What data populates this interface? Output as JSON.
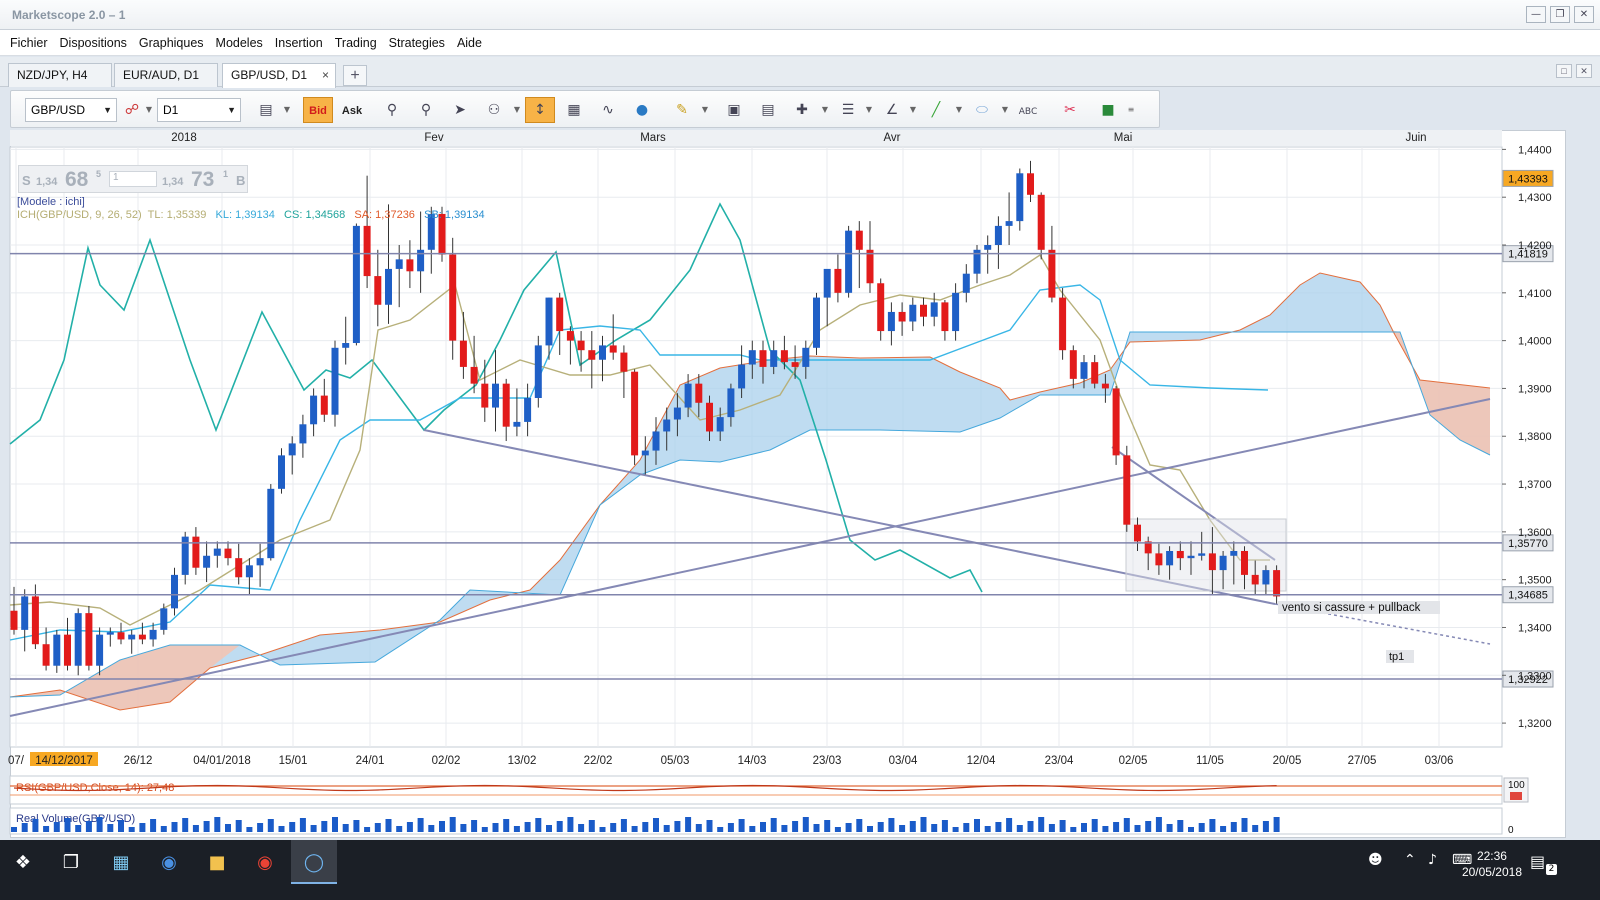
{
  "window": {
    "title": "Marketscope 2.0 – 1",
    "buttons": [
      "minimize",
      "restore",
      "close"
    ]
  },
  "menu": [
    "Fichier",
    "Dispositions",
    "Graphiques",
    "Modeles",
    "Insertion",
    "Trading",
    "Strategies",
    "Aide"
  ],
  "tabs": [
    {
      "label": "NZD/JPY, H4",
      "active": false
    },
    {
      "label": "EUR/AUD, D1",
      "active": false
    },
    {
      "label": "GBP/USD, D1",
      "active": true
    }
  ],
  "toolbar": {
    "instrument": "GBP/USD",
    "timeframe": "D1",
    "bid_label": "Bid",
    "ask_label": "Ask"
  },
  "quote": {
    "sell_prefix": "S",
    "sell_small": "1,34",
    "sell_big": "68",
    "sell_sup": "5",
    "qty": "1",
    "buy_small": "1,34",
    "buy_big": "73",
    "buy_sup": "1",
    "buy_suffix": "B"
  },
  "legend": {
    "model": "[Modele : ichi]",
    "ich_prefix": "ICH(GBP/USD, 9, 26, 52)",
    "tl": "TL: 1,35339",
    "kl": "KL: 1,39134",
    "cs": "CS: 1,34568",
    "sa": "SA: 1,37236",
    "sb": "SB: 1,39134"
  },
  "annotations": {
    "note": "vento si cassure + pullback",
    "tp": "tp1"
  },
  "price_tags": [
    "1,43393",
    "1,41819",
    "1,35770",
    "1,34685",
    "1,32922"
  ],
  "indicators": {
    "rsi": "RSI(GBP/USD,Close, 14): 27,48",
    "rsi_top": "100",
    "volume": "Real Volume(GBP/USD)",
    "vol_zero": "0"
  },
  "taskbar": {
    "time": "22:36",
    "date": "20/05/2018",
    "notifications": "2"
  },
  "chart_data": {
    "type": "candlestick",
    "top_axis_labels": [
      "2018",
      "Fev",
      "Mars",
      "Avr",
      "Mai",
      "Juin"
    ],
    "x_axis_labels": [
      "07/",
      "14/12/2017",
      "26/12",
      "04/01/2018",
      "15/01",
      "24/01",
      "02/02",
      "13/02",
      "22/02",
      "05/03",
      "14/03",
      "23/03",
      "03/04",
      "12/04",
      "23/04",
      "02/05",
      "11/05",
      "20/05",
      "27/05",
      "03/06"
    ],
    "y_ticks": [
      "1,4400",
      "1,4300",
      "1,4200",
      "1,4100",
      "1,4000",
      "1,3900",
      "1,3800",
      "1,3700",
      "1,3600",
      "1,3500",
      "1,3400",
      "1,3300",
      "1,3200"
    ],
    "y_range": [
      1.315,
      1.4405
    ],
    "horizontal_levels": [
      1.41819,
      1.3577,
      1.34685,
      1.32922
    ],
    "current_price": 1.43393,
    "colors": {
      "up": "#1f5fc6",
      "down": "#e21b1b",
      "tenkan": "#b7b07a",
      "kijun": "#39b6e6",
      "chikou": "#22b0a8",
      "span_bull": "#a9d0ec",
      "span_bear": "#f4c3b0",
      "lines": "#8b8fb8"
    },
    "candles": [
      {
        "o": 1.3435,
        "h": 1.3485,
        "l": 1.3385,
        "c": 1.3395
      },
      {
        "o": 1.3395,
        "h": 1.348,
        "l": 1.335,
        "c": 1.3465
      },
      {
        "o": 1.3465,
        "h": 1.349,
        "l": 1.3355,
        "c": 1.3365
      },
      {
        "o": 1.3365,
        "h": 1.34,
        "l": 1.331,
        "c": 1.332
      },
      {
        "o": 1.332,
        "h": 1.3395,
        "l": 1.3305,
        "c": 1.3385
      },
      {
        "o": 1.3385,
        "h": 1.342,
        "l": 1.331,
        "c": 1.332
      },
      {
        "o": 1.332,
        "h": 1.344,
        "l": 1.33,
        "c": 1.343
      },
      {
        "o": 1.343,
        "h": 1.3445,
        "l": 1.331,
        "c": 1.332
      },
      {
        "o": 1.332,
        "h": 1.34,
        "l": 1.33,
        "c": 1.3385
      },
      {
        "o": 1.3385,
        "h": 1.34,
        "l": 1.336,
        "c": 1.339
      },
      {
        "o": 1.339,
        "h": 1.341,
        "l": 1.3365,
        "c": 1.3375
      },
      {
        "o": 1.3375,
        "h": 1.3395,
        "l": 1.3345,
        "c": 1.3385
      },
      {
        "o": 1.3385,
        "h": 1.341,
        "l": 1.3365,
        "c": 1.3375
      },
      {
        "o": 1.3375,
        "h": 1.341,
        "l": 1.336,
        "c": 1.3395
      },
      {
        "o": 1.3395,
        "h": 1.345,
        "l": 1.3385,
        "c": 1.344
      },
      {
        "o": 1.344,
        "h": 1.3525,
        "l": 1.3425,
        "c": 1.351
      },
      {
        "o": 1.351,
        "h": 1.36,
        "l": 1.349,
        "c": 1.359
      },
      {
        "o": 1.359,
        "h": 1.361,
        "l": 1.351,
        "c": 1.3525
      },
      {
        "o": 1.3525,
        "h": 1.358,
        "l": 1.3495,
        "c": 1.355
      },
      {
        "o": 1.355,
        "h": 1.358,
        "l": 1.3525,
        "c": 1.3565
      },
      {
        "o": 1.3565,
        "h": 1.358,
        "l": 1.353,
        "c": 1.3545
      },
      {
        "o": 1.3545,
        "h": 1.3575,
        "l": 1.349,
        "c": 1.3505
      },
      {
        "o": 1.3505,
        "h": 1.3545,
        "l": 1.347,
        "c": 1.353
      },
      {
        "o": 1.353,
        "h": 1.3575,
        "l": 1.3485,
        "c": 1.3545
      },
      {
        "o": 1.3545,
        "h": 1.37,
        "l": 1.354,
        "c": 1.369
      },
      {
        "o": 1.369,
        "h": 1.3775,
        "l": 1.368,
        "c": 1.376
      },
      {
        "o": 1.376,
        "h": 1.38,
        "l": 1.372,
        "c": 1.3785
      },
      {
        "o": 1.3785,
        "h": 1.3845,
        "l": 1.3755,
        "c": 1.3825
      },
      {
        "o": 1.3825,
        "h": 1.39,
        "l": 1.38,
        "c": 1.3885
      },
      {
        "o": 1.3885,
        "h": 1.392,
        "l": 1.383,
        "c": 1.3845
      },
      {
        "o": 1.3845,
        "h": 1.4,
        "l": 1.382,
        "c": 1.3985
      },
      {
        "o": 1.3985,
        "h": 1.405,
        "l": 1.395,
        "c": 1.3995
      },
      {
        "o": 1.3995,
        "h": 1.4245,
        "l": 1.399,
        "c": 1.424
      },
      {
        "o": 1.424,
        "h": 1.4345,
        "l": 1.411,
        "c": 1.4135
      },
      {
        "o": 1.4135,
        "h": 1.419,
        "l": 1.403,
        "c": 1.4075
      },
      {
        "o": 1.4075,
        "h": 1.4285,
        "l": 1.4035,
        "c": 1.415
      },
      {
        "o": 1.415,
        "h": 1.42,
        "l": 1.407,
        "c": 1.417
      },
      {
        "o": 1.417,
        "h": 1.421,
        "l": 1.411,
        "c": 1.4145
      },
      {
        "o": 1.4145,
        "h": 1.427,
        "l": 1.41,
        "c": 1.419
      },
      {
        "o": 1.419,
        "h": 1.428,
        "l": 1.414,
        "c": 1.4265
      },
      {
        "o": 1.4265,
        "h": 1.428,
        "l": 1.4165,
        "c": 1.418
      },
      {
        "o": 1.418,
        "h": 1.4215,
        "l": 1.396,
        "c": 1.4
      },
      {
        "o": 1.4,
        "h": 1.406,
        "l": 1.392,
        "c": 1.3945
      },
      {
        "o": 1.3945,
        "h": 1.401,
        "l": 1.389,
        "c": 1.391
      },
      {
        "o": 1.391,
        "h": 1.396,
        "l": 1.383,
        "c": 1.386
      },
      {
        "o": 1.386,
        "h": 1.398,
        "l": 1.381,
        "c": 1.391
      },
      {
        "o": 1.391,
        "h": 1.392,
        "l": 1.379,
        "c": 1.382
      },
      {
        "o": 1.382,
        "h": 1.39,
        "l": 1.38,
        "c": 1.383
      },
      {
        "o": 1.383,
        "h": 1.391,
        "l": 1.38,
        "c": 1.388
      },
      {
        "o": 1.388,
        "h": 1.401,
        "l": 1.386,
        "c": 1.399
      },
      {
        "o": 1.399,
        "h": 1.409,
        "l": 1.396,
        "c": 1.409
      },
      {
        "o": 1.409,
        "h": 1.41,
        "l": 1.397,
        "c": 1.402
      },
      {
        "o": 1.402,
        "h": 1.403,
        "l": 1.395,
        "c": 1.4
      },
      {
        "o": 1.4,
        "h": 1.402,
        "l": 1.3935,
        "c": 1.398
      },
      {
        "o": 1.398,
        "h": 1.402,
        "l": 1.39,
        "c": 1.396
      },
      {
        "o": 1.396,
        "h": 1.401,
        "l": 1.3915,
        "c": 1.399
      },
      {
        "o": 1.399,
        "h": 1.4055,
        "l": 1.396,
        "c": 1.3975
      },
      {
        "o": 1.3975,
        "h": 1.399,
        "l": 1.388,
        "c": 1.3935
      },
      {
        "o": 1.3935,
        "h": 1.394,
        "l": 1.374,
        "c": 1.376
      },
      {
        "o": 1.376,
        "h": 1.38,
        "l": 1.372,
        "c": 1.377
      },
      {
        "o": 1.377,
        "h": 1.384,
        "l": 1.374,
        "c": 1.381
      },
      {
        "o": 1.381,
        "h": 1.386,
        "l": 1.377,
        "c": 1.3835
      },
      {
        "o": 1.3835,
        "h": 1.389,
        "l": 1.38,
        "c": 1.386
      },
      {
        "o": 1.386,
        "h": 1.393,
        "l": 1.384,
        "c": 1.391
      },
      {
        "o": 1.391,
        "h": 1.393,
        "l": 1.384,
        "c": 1.387
      },
      {
        "o": 1.387,
        "h": 1.3885,
        "l": 1.379,
        "c": 1.381
      },
      {
        "o": 1.381,
        "h": 1.386,
        "l": 1.379,
        "c": 1.384
      },
      {
        "o": 1.384,
        "h": 1.391,
        "l": 1.382,
        "c": 1.39
      },
      {
        "o": 1.39,
        "h": 1.399,
        "l": 1.388,
        "c": 1.395
      },
      {
        "o": 1.395,
        "h": 1.4,
        "l": 1.392,
        "c": 1.398
      },
      {
        "o": 1.398,
        "h": 1.4,
        "l": 1.391,
        "c": 1.3945
      },
      {
        "o": 1.3945,
        "h": 1.4,
        "l": 1.393,
        "c": 1.398
      },
      {
        "o": 1.398,
        "h": 1.401,
        "l": 1.394,
        "c": 1.3955
      },
      {
        "o": 1.3955,
        "h": 1.399,
        "l": 1.392,
        "c": 1.3945
      },
      {
        "o": 1.3945,
        "h": 1.4,
        "l": 1.392,
        "c": 1.3985
      },
      {
        "o": 1.3985,
        "h": 1.41,
        "l": 1.397,
        "c": 1.409
      },
      {
        "o": 1.409,
        "h": 1.413,
        "l": 1.403,
        "c": 1.415
      },
      {
        "o": 1.415,
        "h": 1.418,
        "l": 1.408,
        "c": 1.41
      },
      {
        "o": 1.41,
        "h": 1.424,
        "l": 1.409,
        "c": 1.423
      },
      {
        "o": 1.423,
        "h": 1.425,
        "l": 1.411,
        "c": 1.419
      },
      {
        "o": 1.419,
        "h": 1.425,
        "l": 1.41,
        "c": 1.412
      },
      {
        "o": 1.412,
        "h": 1.413,
        "l": 1.4,
        "c": 1.402
      },
      {
        "o": 1.402,
        "h": 1.408,
        "l": 1.399,
        "c": 1.406
      },
      {
        "o": 1.406,
        "h": 1.408,
        "l": 1.401,
        "c": 1.404
      },
      {
        "o": 1.404,
        "h": 1.409,
        "l": 1.402,
        "c": 1.4075
      },
      {
        "o": 1.4075,
        "h": 1.409,
        "l": 1.403,
        "c": 1.405
      },
      {
        "o": 1.405,
        "h": 1.41,
        "l": 1.403,
        "c": 1.408
      },
      {
        "o": 1.408,
        "h": 1.4085,
        "l": 1.4,
        "c": 1.402
      },
      {
        "o": 1.402,
        "h": 1.412,
        "l": 1.4,
        "c": 1.41
      },
      {
        "o": 1.41,
        "h": 1.416,
        "l": 1.408,
        "c": 1.414
      },
      {
        "o": 1.414,
        "h": 1.42,
        "l": 1.412,
        "c": 1.419
      },
      {
        "o": 1.419,
        "h": 1.422,
        "l": 1.414,
        "c": 1.42
      },
      {
        "o": 1.42,
        "h": 1.426,
        "l": 1.415,
        "c": 1.424
      },
      {
        "o": 1.424,
        "h": 1.431,
        "l": 1.42,
        "c": 1.425
      },
      {
        "o": 1.425,
        "h": 1.436,
        "l": 1.423,
        "c": 1.435
      },
      {
        "o": 1.435,
        "h": 1.4376,
        "l": 1.429,
        "c": 1.4305
      },
      {
        "o": 1.4305,
        "h": 1.431,
        "l": 1.417,
        "c": 1.419
      },
      {
        "o": 1.419,
        "h": 1.424,
        "l": 1.408,
        "c": 1.409
      },
      {
        "o": 1.409,
        "h": 1.411,
        "l": 1.396,
        "c": 1.398
      },
      {
        "o": 1.398,
        "h": 1.399,
        "l": 1.39,
        "c": 1.392
      },
      {
        "o": 1.392,
        "h": 1.397,
        "l": 1.39,
        "c": 1.3955
      },
      {
        "o": 1.3955,
        "h": 1.397,
        "l": 1.39,
        "c": 1.391
      },
      {
        "o": 1.391,
        "h": 1.393,
        "l": 1.387,
        "c": 1.39
      },
      {
        "o": 1.39,
        "h": 1.3905,
        "l": 1.374,
        "c": 1.376
      },
      {
        "o": 1.376,
        "h": 1.378,
        "l": 1.36,
        "c": 1.3615
      },
      {
        "o": 1.3615,
        "h": 1.363,
        "l": 1.356,
        "c": 1.358
      },
      {
        "o": 1.358,
        "h": 1.359,
        "l": 1.352,
        "c": 1.3555
      },
      {
        "o": 1.3555,
        "h": 1.3575,
        "l": 1.351,
        "c": 1.353
      },
      {
        "o": 1.353,
        "h": 1.357,
        "l": 1.35,
        "c": 1.356
      },
      {
        "o": 1.356,
        "h": 1.358,
        "l": 1.352,
        "c": 1.3545
      },
      {
        "o": 1.3545,
        "h": 1.358,
        "l": 1.351,
        "c": 1.355
      },
      {
        "o": 1.355,
        "h": 1.36,
        "l": 1.354,
        "c": 1.3555
      },
      {
        "o": 1.3555,
        "h": 1.361,
        "l": 1.347,
        "c": 1.352
      },
      {
        "o": 1.352,
        "h": 1.356,
        "l": 1.348,
        "c": 1.355
      },
      {
        "o": 1.355,
        "h": 1.358,
        "l": 1.349,
        "c": 1.356
      },
      {
        "o": 1.356,
        "h": 1.357,
        "l": 1.348,
        "c": 1.351
      },
      {
        "o": 1.351,
        "h": 1.354,
        "l": 1.347,
        "c": 1.349
      },
      {
        "o": 1.349,
        "h": 1.353,
        "l": 1.347,
        "c": 1.352
      },
      {
        "o": 1.352,
        "h": 1.353,
        "l": 1.345,
        "c": 1.3465
      }
    ]
  }
}
